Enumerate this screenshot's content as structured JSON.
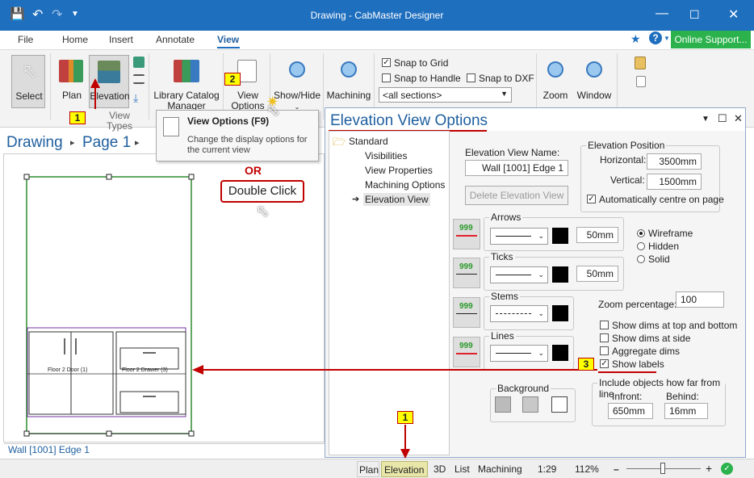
{
  "window": {
    "title": "Drawing - CabMaster Designer"
  },
  "menu": {
    "file": "File",
    "home": "Home",
    "insert": "Insert",
    "annotate": "Annotate",
    "view": "View",
    "online_support": "Online Support..."
  },
  "ribbon": {
    "select": "Select",
    "plan": "Plan",
    "elevation": "Elevation",
    "view_types": "View Types",
    "library_catalog_manager": "Library Catalog Manager",
    "view_options": "View Options",
    "show_hide": "Show/Hide",
    "machining": "Machining",
    "zoom": "Zoom",
    "window": "Window",
    "snap_to_grid": "Snap to Grid",
    "snap_to_handle": "Snap to Handle",
    "snap_to_dxf": "Snap to DXF",
    "sections_value": "<all sections>"
  },
  "tooltip": {
    "title": "View Options (F9)",
    "body": "Change the display options for the current view"
  },
  "breadcrumb": {
    "drawing": "Drawing",
    "page": "Page 1"
  },
  "canvas": {
    "or_text": "OR",
    "double_click": "Double Click",
    "door_label": "Floor 2 Door (1)",
    "drawer_label": "Floor 2 Drawer (3)",
    "tab": "Wall [1001] Edge 1"
  },
  "markers": {
    "one": "1",
    "two": "2",
    "three": "3"
  },
  "panel": {
    "title": "Elevation View Options",
    "tree": [
      "Standard",
      "Visibilities",
      "View Properties",
      "Machining Options",
      "Elevation View"
    ],
    "view_name_label": "Elevation View Name:",
    "view_name_value": "Wall [1001] Edge 1",
    "delete_button": "Delete Elevation View",
    "position_group": "Elevation Position",
    "horizontal_label": "Horizontal:",
    "horizontal_value": "3500mm",
    "vertical_label": "Vertical:",
    "vertical_value": "1500mm",
    "auto_centre": "Automatically centre on page",
    "arrows": "Arrows",
    "arrows_size": "50mm",
    "ticks": "Ticks",
    "ticks_size": "50mm",
    "stems": "Stems",
    "lines": "Lines",
    "dim_icon_text": "999",
    "wireframe": "Wireframe",
    "hidden": "Hidden",
    "solid": "Solid",
    "zoom_percentage_label": "Zoom percentage:",
    "zoom_percentage_value": "100",
    "show_dims_top_bottom": "Show dims at top and bottom",
    "show_dims_side": "Show dims at side",
    "aggregate_dims": "Aggregate dims",
    "show_labels": "Show labels",
    "background": "Background",
    "include_group": "Include objects how far from line",
    "infront_label": "Infront:",
    "infront_value": "650mm",
    "behind_label": "Behind:",
    "behind_value": "16mm"
  },
  "status": {
    "plan": "Plan",
    "elevation": "Elevation",
    "threed": "3D",
    "list": "List",
    "machining": "Machining",
    "scale": "1:29",
    "zoom": "112%"
  },
  "colors": {
    "accent": "#1f6fbf",
    "marker_fill": "#ffff00",
    "annotation_red": "#c00000",
    "online_green": "#2bb24c"
  }
}
